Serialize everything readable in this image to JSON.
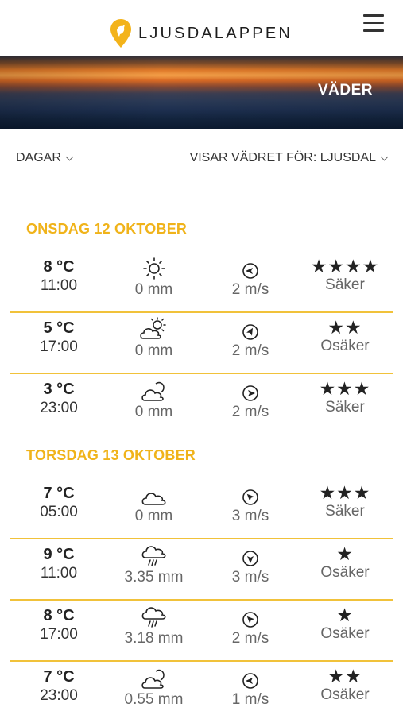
{
  "header": {
    "app_name": "LJUSDALAPPEN"
  },
  "banner": {
    "title": "VÄDER"
  },
  "filters": {
    "days_label": "DAGAR",
    "location_label": "VISAR VÄDRET FÖR: LJUSDAL"
  },
  "days": [
    {
      "heading": "ONSDAG 12 OKTOBER",
      "rows": [
        {
          "temp": "8 °C",
          "time": "11:00",
          "weather_icon": "sun-icon",
          "precip": "0 mm",
          "wind_dir_icon": "wind-arrow-west",
          "wind": "2 m/s",
          "stars": "★★★★",
          "reliability": "Säker"
        },
        {
          "temp": "5 °C",
          "time": "17:00",
          "weather_icon": "partly-sunny-icon",
          "precip": "0 mm",
          "wind_dir_icon": "wind-arrow-northeast",
          "wind": "2 m/s",
          "stars": "★★",
          "reliability": "Osäker"
        },
        {
          "temp": "3 °C",
          "time": "23:00",
          "weather_icon": "partly-cloudy-night-icon",
          "precip": "0 mm",
          "wind_dir_icon": "wind-arrow-east",
          "wind": "2 m/s",
          "stars": "★★★",
          "reliability": "Säker"
        }
      ]
    },
    {
      "heading": "TORSDAG 13 OKTOBER",
      "rows": [
        {
          "temp": "7 °C",
          "time": "05:00",
          "weather_icon": "cloud-icon",
          "precip": "0 mm",
          "wind_dir_icon": "wind-arrow-northwest",
          "wind": "3 m/s",
          "stars": "★★★",
          "reliability": "Säker"
        },
        {
          "temp": "9 °C",
          "time": "11:00",
          "weather_icon": "rain-icon",
          "precip": "3.35 mm",
          "wind_dir_icon": "wind-arrow-south",
          "wind": "3 m/s",
          "stars": "★",
          "reliability": "Osäker"
        },
        {
          "temp": "8 °C",
          "time": "17:00",
          "weather_icon": "rain-icon",
          "precip": "3.18 mm",
          "wind_dir_icon": "wind-arrow-northwest",
          "wind": "2 m/s",
          "stars": "★",
          "reliability": "Osäker"
        },
        {
          "temp": "7 °C",
          "time": "23:00",
          "weather_icon": "partly-cloudy-night-icon",
          "precip": "0.55 mm",
          "wind_dir_icon": "wind-arrow-west",
          "wind": "1 m/s",
          "stars": "★★",
          "reliability": "Osäker"
        }
      ]
    }
  ],
  "colors": {
    "accent": "#f0b31a",
    "separator": "#f1c23a"
  }
}
